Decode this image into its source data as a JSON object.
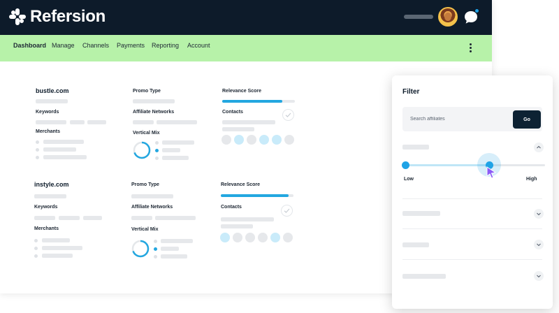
{
  "app": {
    "title": "Refersion"
  },
  "nav": {
    "items": [
      {
        "label": "Dashboard",
        "active": true
      },
      {
        "label": "Manage"
      },
      {
        "label": "Channels"
      },
      {
        "label": "Payments"
      },
      {
        "label": "Reporting"
      },
      {
        "label": "Account"
      }
    ]
  },
  "cards": [
    {
      "domain": "bustle.com",
      "keywords_label": "Keywords",
      "merchants_label": "Merchants",
      "promo_label": "Promo Type",
      "networks_label": "Affiliate Networks",
      "vertical_label": "Vertical Mix",
      "relevance_label": "Relevance Score",
      "relevance_value": 0.83,
      "contacts_label": "Contacts"
    },
    {
      "domain": "instyle.com",
      "keywords_label": "Keywords",
      "merchants_label": "Merchants",
      "promo_label": "Promo Type",
      "networks_label": "Affiliate Networks",
      "vertical_label": "Vertical Mix",
      "relevance_label": "Relevance Score",
      "relevance_value": 0.93,
      "contacts_label": "Contacts"
    }
  ],
  "filter": {
    "title": "Filter",
    "search_placeholder": "Search affiliates",
    "go_label": "Go",
    "slider": {
      "min_label": "Low",
      "max_label": "High",
      "value": 0.6
    }
  },
  "colors": {
    "header": "#0d1b2a",
    "nav": "#b7f2a9",
    "accent": "#23a7e0"
  },
  "icons": [
    "logo-mark-icon",
    "chat-icon",
    "more-vertical-icon",
    "check-icon",
    "chevron-up-icon",
    "chevron-down-icon",
    "cursor-icon"
  ]
}
